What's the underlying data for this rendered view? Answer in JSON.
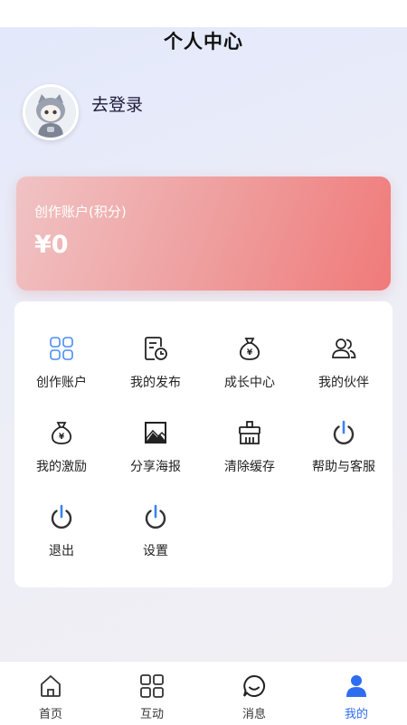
{
  "header": {
    "title": "个人中心"
  },
  "profile": {
    "login_text": "去登录",
    "avatar_icon": "robot-avatar-icon"
  },
  "account_card": {
    "label": "创作账户(积分)",
    "amount": "¥0"
  },
  "menu": [
    {
      "label": "创作账户",
      "icon": "grid-icon"
    },
    {
      "label": "我的发布",
      "icon": "document-clock-icon"
    },
    {
      "label": "成长中心",
      "icon": "money-bag-icon"
    },
    {
      "label": "我的伙伴",
      "icon": "users-icon"
    },
    {
      "label": "我的激励",
      "icon": "money-bag-icon"
    },
    {
      "label": "分享海报",
      "icon": "image-icon"
    },
    {
      "label": "清除缓存",
      "icon": "broom-icon"
    },
    {
      "label": "帮助与客服",
      "icon": "power-icon"
    },
    {
      "label": "退出",
      "icon": "power-icon"
    },
    {
      "label": "设置",
      "icon": "power-icon"
    }
  ],
  "tabbar": {
    "items": [
      {
        "label": "首页",
        "icon": "home-icon"
      },
      {
        "label": "互动",
        "icon": "grid-icon"
      },
      {
        "label": "消息",
        "icon": "chat-icon"
      },
      {
        "label": "我的",
        "icon": "user-icon"
      }
    ],
    "active_index": 3,
    "active_color": "#2f6df0"
  },
  "colors": {
    "card_gradient_start": "#f0c3c4",
    "card_gradient_end": "#f07a7a",
    "accent_blue": "#2f6df0"
  }
}
